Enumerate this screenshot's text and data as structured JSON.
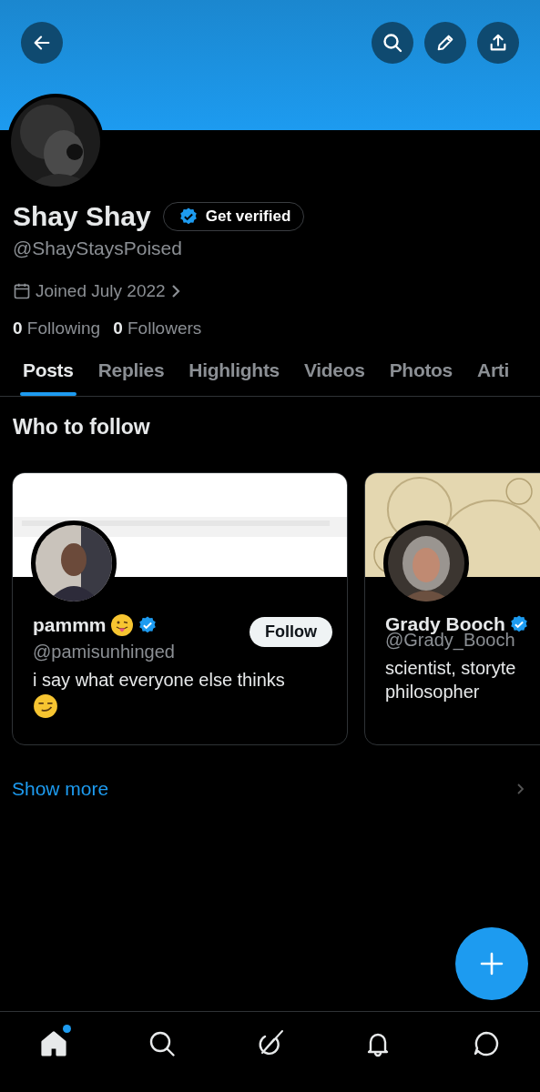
{
  "profile": {
    "name": "Shay Shay",
    "verify_button": "Get verified",
    "handle": "@ShayStaysPoised",
    "joined": "Joined July 2022",
    "following_count": "0",
    "following_label": "Following",
    "followers_count": "0",
    "followers_label": "Followers"
  },
  "tabs": [
    {
      "label": "Posts",
      "selected": true
    },
    {
      "label": "Replies",
      "selected": false
    },
    {
      "label": "Highlights",
      "selected": false
    },
    {
      "label": "Videos",
      "selected": false
    },
    {
      "label": "Photos",
      "selected": false
    },
    {
      "label": "Arti",
      "selected": false
    }
  ],
  "who_to_follow": {
    "title": "Who to follow",
    "show_more": "Show more",
    "cards": [
      {
        "name": "pammm",
        "verified": true,
        "handle": "@pamisunhinged",
        "bio": "i say what everyone else thinks",
        "follow_button": "Follow"
      },
      {
        "name": "Grady Booch",
        "verified": true,
        "handle": "@Grady_Booch",
        "bio": "scientist, storyte",
        "bio_line_2": "philosopher"
      }
    ]
  },
  "nav": [
    {
      "kind": "home",
      "selected": true,
      "dot": true
    },
    {
      "kind": "search",
      "selected": false,
      "dot": false
    },
    {
      "kind": "grok",
      "selected": false,
      "dot": false
    },
    {
      "kind": "bell",
      "selected": false,
      "dot": false
    },
    {
      "kind": "chat",
      "selected": false,
      "dot": false
    }
  ]
}
